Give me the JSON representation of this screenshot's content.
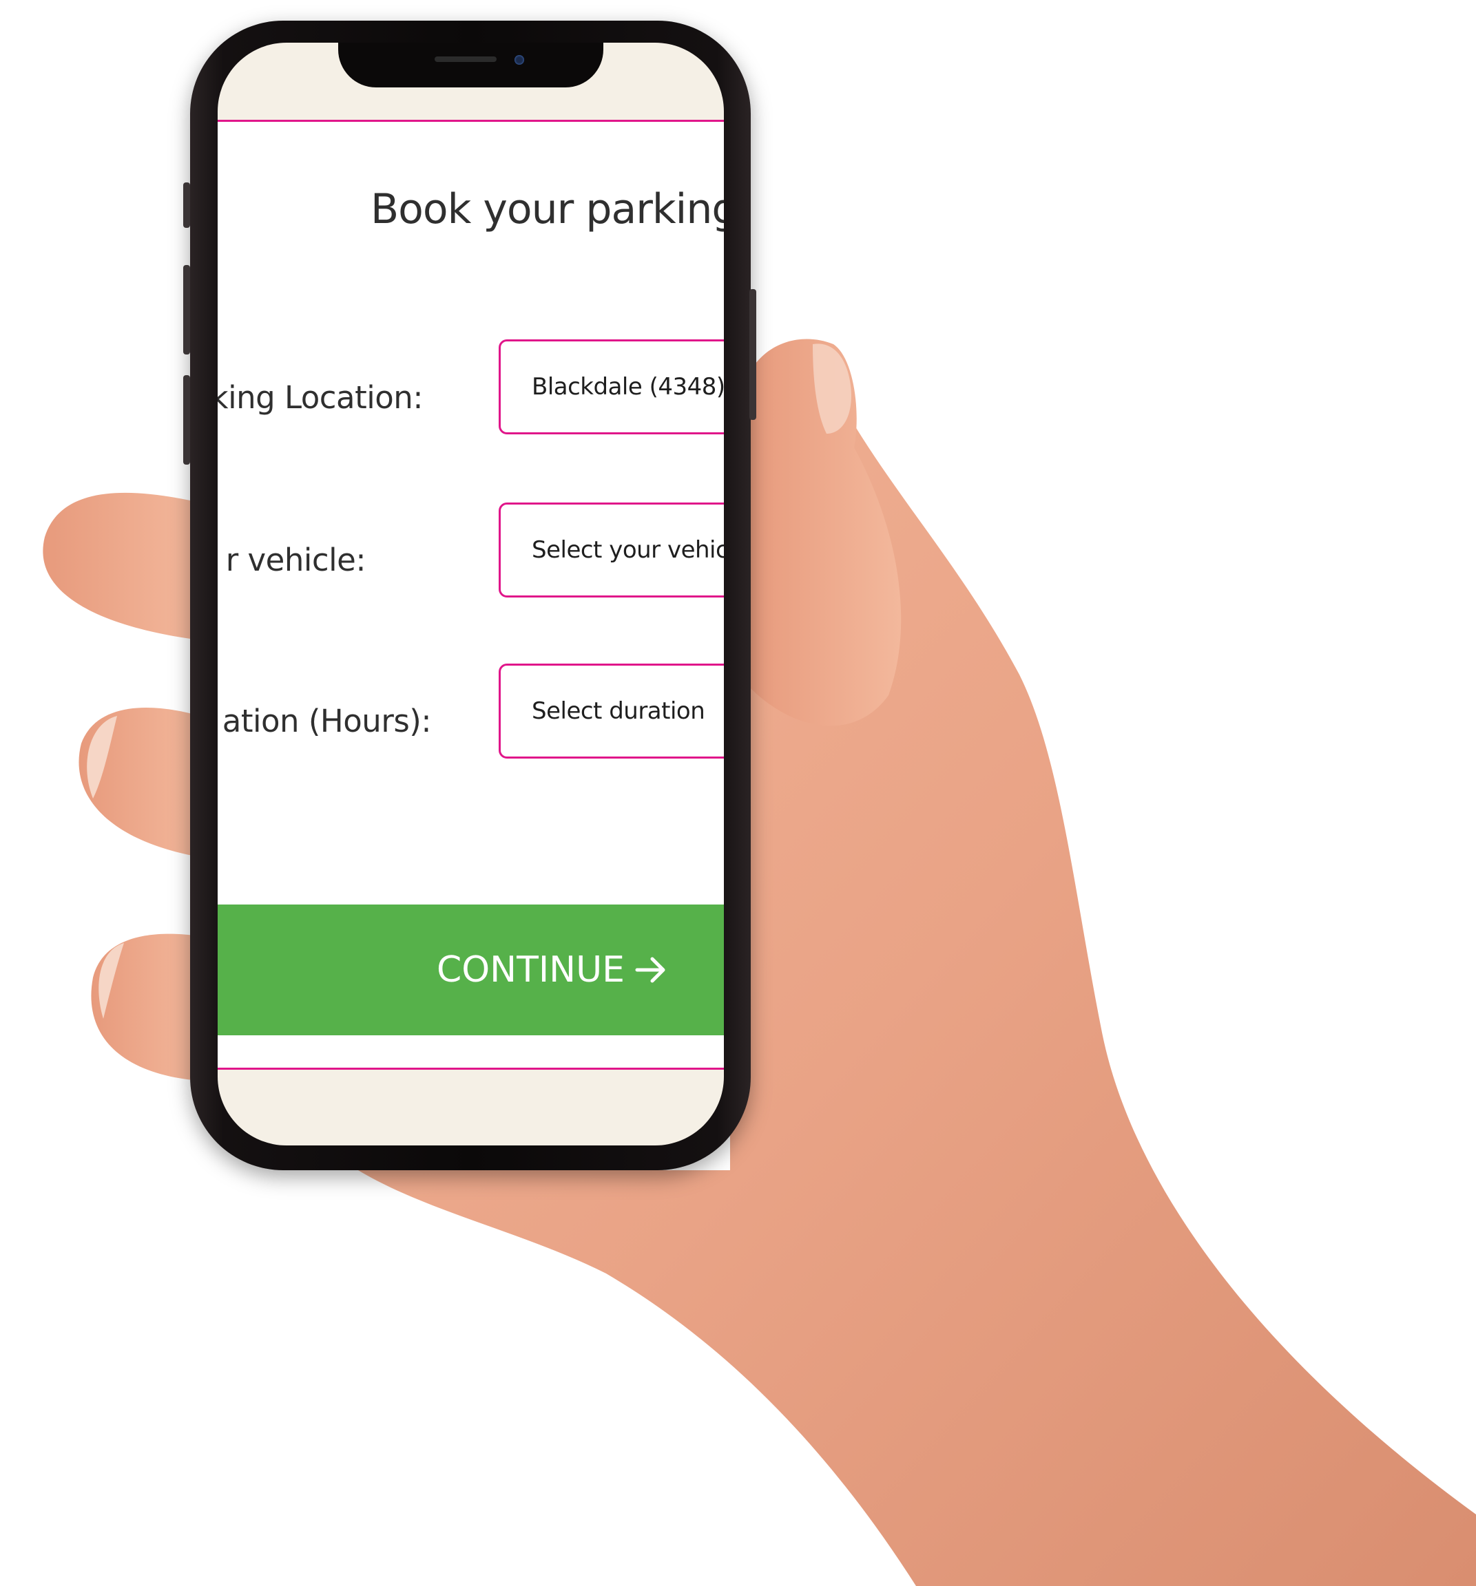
{
  "page": {
    "title": "Book your parking"
  },
  "form": {
    "fields": [
      {
        "label": "king Location:",
        "value": "Blackdale (4348)",
        "kind": "select"
      },
      {
        "label": "r vehicle:",
        "value": "Select your vehicle",
        "kind": "select"
      },
      {
        "label": "ation (Hours):",
        "value": "Select duration",
        "kind": "select"
      }
    ]
  },
  "actions": {
    "continue_label": "CONTINUE",
    "continue_icon": "arrow-right-icon"
  },
  "colors": {
    "accent": "#e0168a",
    "button": "#56b14a",
    "safe_area": "#f5f0e6",
    "text": "#2f2f2f"
  }
}
